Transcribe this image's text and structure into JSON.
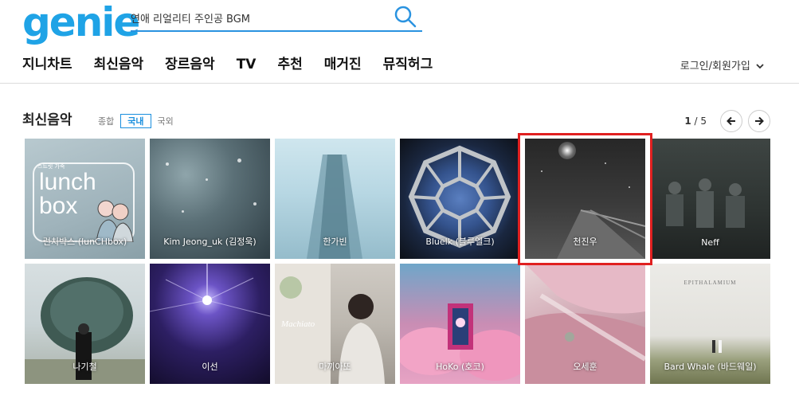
{
  "header": {
    "logo": "genie",
    "search_value": "연애 리얼리티 주인공 BGM",
    "login_label": "로그인/회원가입"
  },
  "nav": {
    "items": [
      "지니차트",
      "최신음악",
      "장르음악",
      "TV",
      "추천",
      "매거진",
      "뮤직허그"
    ]
  },
  "section": {
    "title": "최신음악",
    "filters": [
      "종합",
      "국내",
      "국외"
    ],
    "active_filter": "국내",
    "page_current": "1",
    "page_total": "/ 5"
  },
  "tiles": [
    {
      "caption": "런치박스 (lunCHbox)",
      "art_text": "lunch box",
      "art_small": "스트릿 가죽"
    },
    {
      "caption": "Kim Jeong_uk (김정욱)"
    },
    {
      "caption": "한가빈"
    },
    {
      "caption": "Bluelk (블루엘크)"
    },
    {
      "caption": "천진우"
    },
    {
      "caption": "Neff"
    },
    {
      "caption": "나기철"
    },
    {
      "caption": "이선"
    },
    {
      "caption": "마끼아또",
      "art_text": "Machiato"
    },
    {
      "caption": "HoKo (호코)"
    },
    {
      "caption": "오세훈"
    },
    {
      "caption": "Bard Whale (바드웨일)",
      "art_text": "EPITHALAMIUM"
    }
  ],
  "colors": {
    "brand": "#1fa3e6",
    "search_line": "#2a93e0",
    "active_filter": "#1a8fde",
    "highlight": "#e02020"
  },
  "icons": {
    "search": "search-icon",
    "prev": "arrow-left-icon",
    "next": "arrow-right-icon",
    "login_chevron": "chevron-down-icon"
  }
}
